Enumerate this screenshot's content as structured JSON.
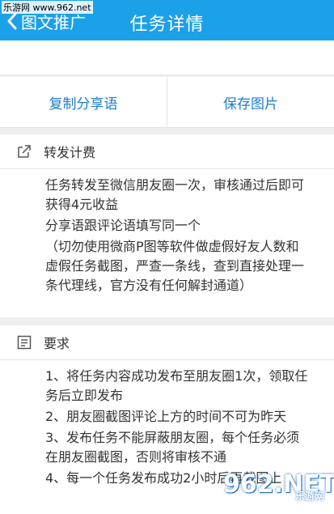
{
  "watermark": "乐游网 www.962.net",
  "header": {
    "back_label": "图文推广",
    "title": "任务详情"
  },
  "actions": {
    "copy_label": "复制分享语",
    "save_label": "保存图片"
  },
  "fee": {
    "heading": "转发计费",
    "lines": [
      "任务转发至微信朋友圈一次，审核通过后即可获得4元收益",
      "分享语跟评论语填写同一个",
      "（切勿使用微商P图等软件做虚假好友人数和虚假任务截图，严查一条线，查到直接处理一条代理线，官方没有任何解封通道）"
    ]
  },
  "req": {
    "heading": "要求",
    "lines": [
      "1、将任务内容成功发布至朋友圈1次，领取任务后立即发布",
      "2、朋友圈截图评论上方的时间不可为昨天",
      "3、发布任务不能屏蔽朋友圈，每个任务必须在朋友圈截图，否则将审核不通",
      "4、每一个任务发布成功2小时后再截图上"
    ]
  },
  "corner_logo": {
    "big": "962.NET",
    "small": "乐游网"
  }
}
